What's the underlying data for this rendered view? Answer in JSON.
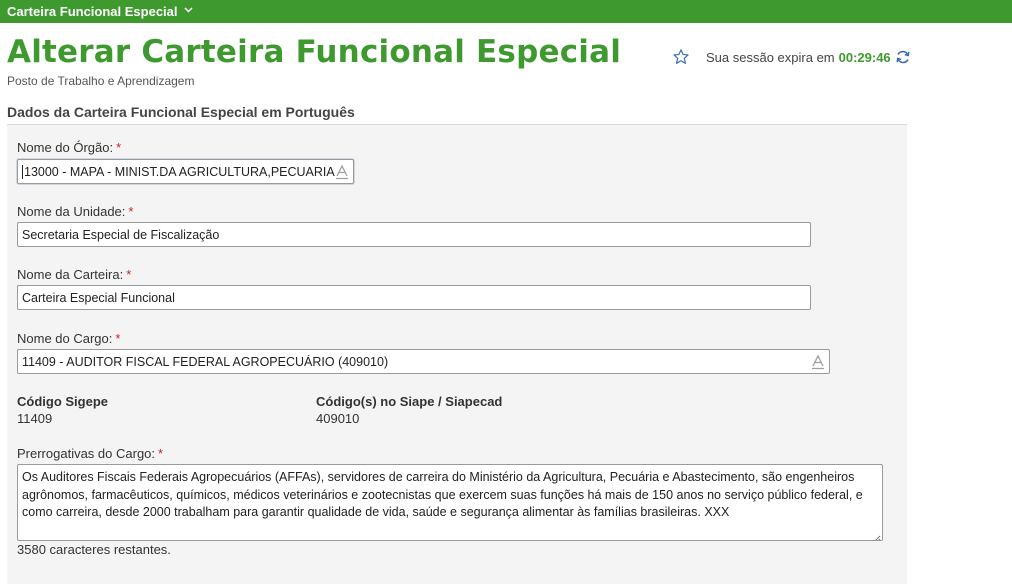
{
  "topbar": {
    "menu_title": "Carteira Funcional Especial"
  },
  "header": {
    "title": "Alterar Carteira Funcional Especial",
    "subtitle": "Posto de Trabalho e Aprendizagem",
    "session_label": "Sua sessão expira em",
    "session_time": "00:29:46"
  },
  "section": {
    "title": "Dados da Carteira Funcional Especial em Português"
  },
  "form": {
    "orgao": {
      "label": "Nome do Órgão:",
      "required": "*",
      "value": "13000 - MAPA - MINIST.DA AGRICULTURA,PECUARIA"
    },
    "unidade": {
      "label": "Nome da Unidade:",
      "required": "*",
      "value": "Secretaria Especial de Fiscalização"
    },
    "carteira": {
      "label": "Nome da Carteira:",
      "required": "*",
      "value": "Carteira Especial Funcional"
    },
    "cargo": {
      "label": "Nome do Cargo:",
      "required": "*",
      "value": "11409 - AUDITOR FISCAL FEDERAL AGROPECUÁRIO (409010)"
    },
    "sigepe": {
      "label": "Código Sigepe",
      "value": "11409"
    },
    "siape": {
      "label": "Código(s) no Siape / Siapecad",
      "value": "409010"
    },
    "prerrogativas": {
      "label": "Prerrogativas do Cargo:",
      "required": "*",
      "value": "Os Auditores Fiscais Federais Agropecuários (AFFAs), servidores de carreira do Ministério da Agricultura, Pecuária e Abastecimento, são engenheiros agrônomos, farmacêuticos, químicos, médicos veterinários e zootecnistas que exercem suas funções há mais de 150 anos no serviço público federal, e como carreira, desde 2000 trabalham para garantir qualidade de vida, saúde e segurança alimentar às famílias brasileiras. XXX",
      "chars_left": "3580 caracteres restantes."
    }
  },
  "colors": {
    "brand_green": "#3e9a2e",
    "required_red": "#cc2222"
  },
  "icons": [
    "chevron-down-icon",
    "star-icon",
    "refresh-icon",
    "autocomplete-icon"
  ]
}
